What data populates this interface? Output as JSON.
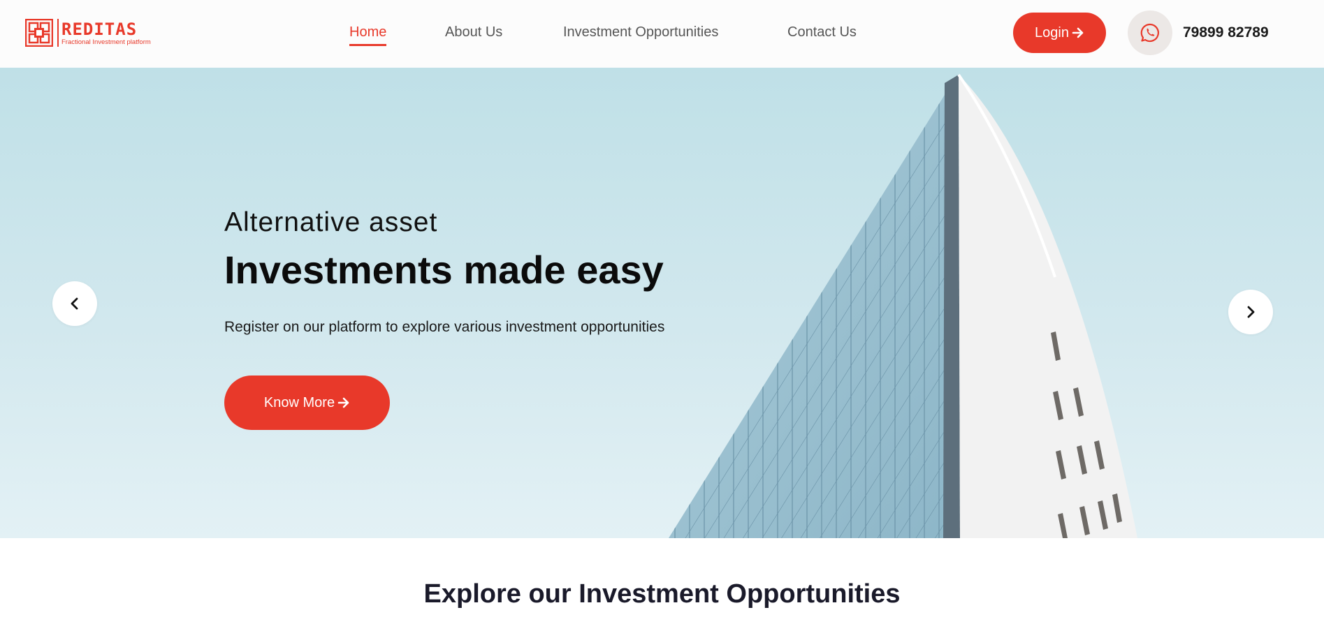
{
  "brand": {
    "name": "REDITAS",
    "tagline": "Fractional Investment platform",
    "color": "#e8392a"
  },
  "nav": {
    "items": [
      {
        "label": "Home",
        "active": true
      },
      {
        "label": "About Us",
        "active": false
      },
      {
        "label": "Investment Opportunities",
        "active": false
      },
      {
        "label": "Contact Us",
        "active": false
      }
    ]
  },
  "header": {
    "login_label": "Login",
    "login_icon": "arrow-right-icon",
    "whatsapp_icon": "whatsapp-icon",
    "phone": "79899 82789"
  },
  "hero": {
    "subtitle": "Alternative asset",
    "title": "Investments made easy",
    "description": "Register on our platform to explore various investment opportunities",
    "cta_label": "Know More",
    "cta_icon": "arrow-right-icon",
    "prev_icon": "chevron-left-icon",
    "next_icon": "chevron-right-icon"
  },
  "explore": {
    "title": "Explore our Investment Opportunities"
  }
}
